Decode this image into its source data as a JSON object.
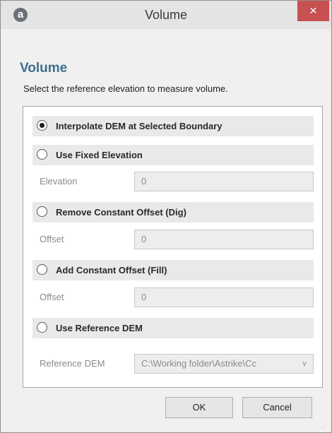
{
  "window": {
    "title": "Volume",
    "app_icon": "a",
    "close_glyph": "✕"
  },
  "header": {
    "heading": "Volume",
    "subtitle": "Select the reference elevation to measure volume."
  },
  "options": [
    {
      "label": "Interpolate DEM at Selected Boundary",
      "selected": true
    },
    {
      "label": "Use Fixed Elevation",
      "selected": false
    },
    {
      "label": "Remove Constant Offset (Dig)",
      "selected": false
    },
    {
      "label": "Add Constant Offset (Fill)",
      "selected": false
    },
    {
      "label": "Use Reference DEM",
      "selected": false
    }
  ],
  "fields": {
    "elevation": {
      "label": "Elevation",
      "value": "0"
    },
    "dig_offset": {
      "label": "Offset",
      "value": "0"
    },
    "fill_offset": {
      "label": "Offset",
      "value": "0"
    },
    "reference_dem": {
      "label": "Reference DEM",
      "value": "C:\\Working folder\\Astrike\\Cc"
    }
  },
  "buttons": {
    "ok": "OK",
    "cancel": "Cancel"
  },
  "colors": {
    "heading": "#3e6f8f",
    "close_button": "#c75050"
  }
}
